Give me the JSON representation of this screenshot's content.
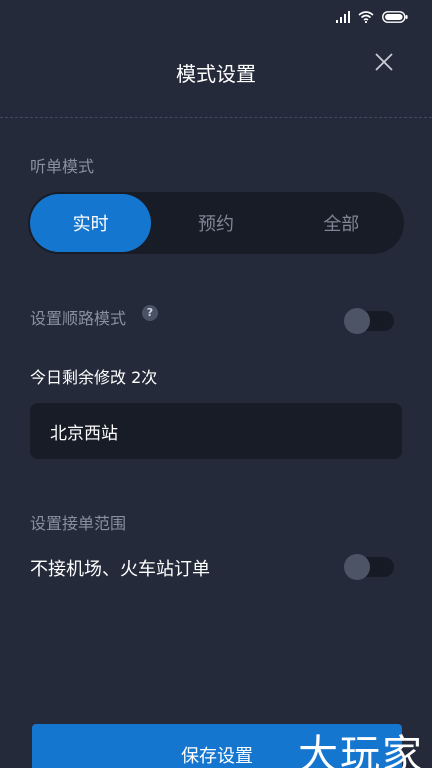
{
  "header": {
    "title": "模式设置"
  },
  "listen_mode": {
    "label": "听单模式",
    "options": [
      {
        "label": "实时",
        "active": true
      },
      {
        "label": "预约",
        "active": false
      },
      {
        "label": "全部",
        "active": false
      }
    ]
  },
  "route_mode": {
    "label": "设置顺路模式",
    "help_glyph": "?",
    "enabled": false,
    "remaining_text": "今日剩余修改 2次",
    "station_value": "北京西站"
  },
  "order_range": {
    "label": "设置接单范围",
    "option_text": "不接机场、火车站订单",
    "enabled": false
  },
  "footer": {
    "save_label": "保存设置"
  },
  "watermark": {
    "text": "大玩家"
  },
  "colors": {
    "background": "#242a3a",
    "accent": "#1576cf",
    "panel": "#181c27",
    "muted": "#8a90a0"
  },
  "icons": {
    "signal": "signal-icon",
    "wifi": "wifi-icon",
    "battery": "battery-icon",
    "close": "close-icon",
    "help": "help-icon"
  }
}
